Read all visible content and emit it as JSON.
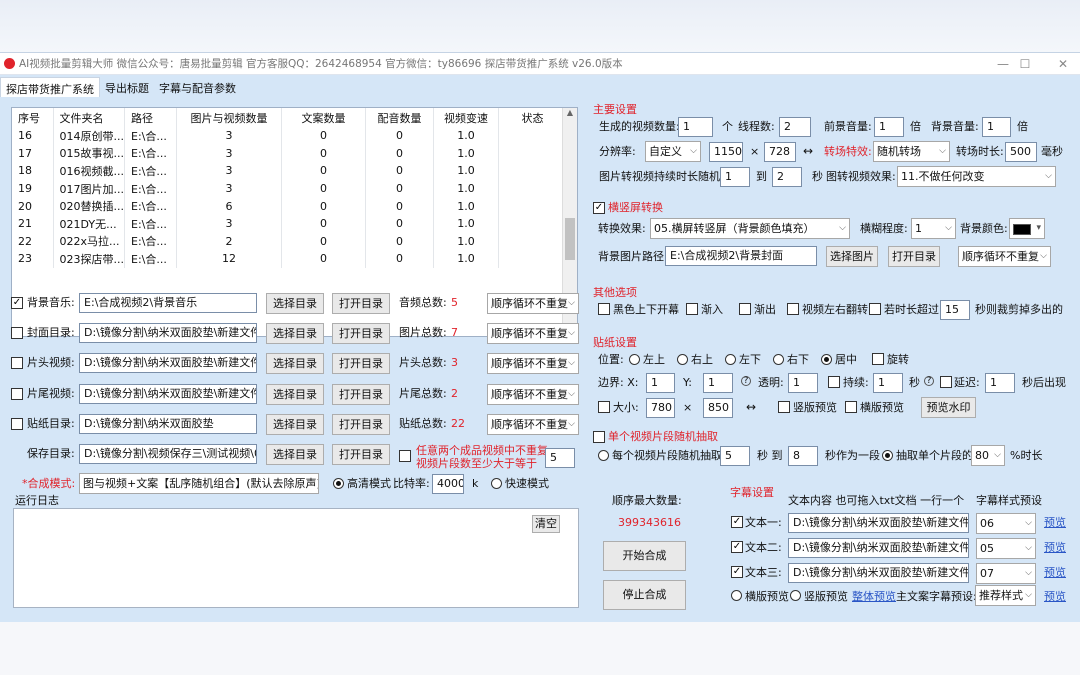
{
  "window": {
    "title": "AI视频批量剪辑大师  微信公众号：唐易批量剪辑  官方客服QQ：2642468954  官方微信：ty86696     探店带货推广系统    v26.0版本",
    "btn_min": "—",
    "btn_max": "☐",
    "btn_close": "✕"
  },
  "tabs": [
    {
      "label": "探店带货推广系统"
    },
    {
      "label": "导出标题"
    },
    {
      "label": "字幕与配音参数"
    }
  ],
  "table": {
    "headers": [
      "序号",
      "文件夹名",
      "路径",
      "图片与视频数量",
      "文案数量",
      "配音数量",
      "视频变速",
      "状态"
    ],
    "rows": [
      [
        "16",
        "014原创带...",
        "E:\\合...",
        "3",
        "0",
        "0",
        "1.0",
        ""
      ],
      [
        "17",
        "015故事视...",
        "E:\\合...",
        "3",
        "0",
        "0",
        "1.0",
        ""
      ],
      [
        "18",
        "016视频截...",
        "E:\\合...",
        "3",
        "0",
        "0",
        "1.0",
        ""
      ],
      [
        "19",
        "017图片加...",
        "E:\\合...",
        "3",
        "0",
        "0",
        "1.0",
        ""
      ],
      [
        "20",
        "020替换插...",
        "E:\\合...",
        "6",
        "0",
        "0",
        "1.0",
        ""
      ],
      [
        "21",
        "021DY无...",
        "E:\\合...",
        "3",
        "0",
        "0",
        "1.0",
        ""
      ],
      [
        "22",
        "022x马拉...",
        "E:\\合...",
        "2",
        "0",
        "0",
        "1.0",
        ""
      ],
      [
        "23",
        "023探店带...",
        "E:\\合...",
        "12",
        "0",
        "0",
        "1.0",
        ""
      ]
    ]
  },
  "dirs": [
    {
      "label": "背景音乐:",
      "checked": true,
      "path": "E:\\合成视频2\\背景音乐",
      "btn1": "选择目录",
      "btn2": "打开目录",
      "count_label": "音频总数:",
      "count": "5",
      "mode": "顺序循环不重复"
    },
    {
      "label": "封面目录:",
      "checked": false,
      "path": "D:\\镜像分割\\纳米双面胶垫\\新建文件夹",
      "btn1": "选择目录",
      "btn2": "打开目录",
      "count_label": "图片总数:",
      "count": "7",
      "mode": "顺序循环不重复"
    },
    {
      "label": "片头视频:",
      "checked": false,
      "path": "D:\\镜像分割\\纳米双面胶垫\\新建文件夹",
      "btn1": "选择目录",
      "btn2": "打开目录",
      "count_label": "片头总数:",
      "count": "3",
      "mode": "顺序循环不重复"
    },
    {
      "label": "片尾视频:",
      "checked": false,
      "path": "D:\\镜像分割\\纳米双面胶垫\\新建文件夹",
      "btn1": "选择目录",
      "btn2": "打开目录",
      "count_label": "片尾总数:",
      "count": "2",
      "mode": "顺序循环不重复"
    },
    {
      "label": "贴纸目录:",
      "checked": false,
      "path": "D:\\镜像分割\\纳米双面胶垫",
      "btn1": "选择目录",
      "btn2": "打开目录",
      "count_label": "贴纸总数:",
      "count": "22",
      "mode": "顺序循环不重复"
    }
  ],
  "save": {
    "label": "保存目录:",
    "path": "D:\\镜像分割\\视频保存三\\测试视频\\040",
    "btn1": "选择目录",
    "btn2": "打开目录",
    "note": "任意两个成品视频中不重复\n视频片段数至少大于等于",
    "note_value": "5"
  },
  "mode": {
    "label": "*合成模式:",
    "value": "图与视频+文案【乱序随机组合】(默认去除原声)",
    "hq": "高清模式",
    "bitrate_label": "比特率:",
    "bitrate": "4000",
    "k": "k",
    "fast": "快速模式"
  },
  "log": {
    "label": "运行日志",
    "clear": "清空"
  },
  "main": {
    "title": "主要设置",
    "gen_label": "生成的视频数量:",
    "gen": "1",
    "ge": "个",
    "threads_label": "线程数:",
    "threads": "2",
    "fg_vol_label": "前景音量:",
    "fg_vol": "1",
    "bei": "倍",
    "bg_vol_label": "背景音量:",
    "bg_vol": "1",
    "bei2": "倍",
    "res_label": "分辨率:",
    "res_mode": "自定义",
    "w": "1150",
    "x": "×",
    "h": "728",
    "swap": "↔",
    "trans_label": "转场特效:",
    "trans": "随机转场",
    "trans_dur_label": "转场时长:",
    "trans_dur": "500",
    "ms": "毫秒",
    "imgdur_label": "图片转视频持续时长随机:",
    "imgdur_a": "1",
    "to": "到",
    "imgdur_b": "2",
    "sec": "秒",
    "imgeff_label": "图转视频效果:",
    "imgeff": "11.不做任何改变"
  },
  "portrait": {
    "title": "横竖屏转换",
    "effect_label": "转换效果:",
    "effect": "05.横屏转竖屏（背景颜色填充）",
    "blur_label": "横糊程度:",
    "blur": "1",
    "color_label": "背景颜色:",
    "bgimg_label": "背景图片路径:",
    "bgimg": "E:\\合成视频2\\背景封面",
    "btn1": "选择图片",
    "btn2": "打开目录",
    "mode": "顺序循环不重复"
  },
  "other": {
    "title": "其他选项",
    "o1": "黑色上下开幕",
    "o2": "渐入",
    "o3": "渐出",
    "o4": "视频左右翻转",
    "o5": "若时长超过",
    "o5_val": "15",
    "o5_tail": "秒则裁剪掉多出的"
  },
  "sticker": {
    "title": "贴纸设置",
    "pos_label": "位置:",
    "pos": [
      "左上",
      "右上",
      "左下",
      "右下",
      "居中"
    ],
    "rotate": "旋转",
    "margin_label": "边界:  X:",
    "x": "1",
    "y_label": "Y:",
    "y": "1",
    "alpha_label": "透明:",
    "alpha": "1",
    "last_label": "持续:",
    "last": "1",
    "sec": "秒",
    "delay_label": "延迟:",
    "delay": "1",
    "delay_tail": "秒后出现",
    "size_label": "大小:",
    "sw": "780",
    "sx": "×",
    "sh": "850",
    "swap": "↔",
    "portrait_prev": "竖版预览",
    "landscape_prev": "横版预览",
    "watermark": "预览水印"
  },
  "clip": {
    "title": "单个视频片段随机抽取",
    "opt1": "每个视频片段随机抽取",
    "a": "5",
    "sec_to": "秒 到",
    "b": "8",
    "tail1": "秒作为一段",
    "opt2": "抽取单个片段的",
    "pct": "80",
    "tail2": "%时长"
  },
  "order": {
    "label": "顺序最大数量:",
    "value": "399343616",
    "start": "开始合成",
    "stop": "停止合成"
  },
  "sub": {
    "title": "字幕设置",
    "content_label": "文本内容  也可拖入txt文档  一行一个",
    "style_label": "字幕样式预设",
    "items": [
      {
        "label": "文本一:",
        "path": "D:\\镜像分割\\纳米双面胶垫\\新建文件夹",
        "style": "06",
        "preview": "预览"
      },
      {
        "label": "文本二:",
        "path": "D:\\镜像分割\\纳米双面胶垫\\新建文件夹",
        "style": "05",
        "preview": "预览"
      },
      {
        "label": "文本三:",
        "path": "D:\\镜像分割\\纳米双面胶垫\\新建文件夹",
        "style": "07",
        "preview": "预览"
      }
    ],
    "landscape": "横版预览",
    "portrait": "竖版预览",
    "whole": "整体预览",
    "main_style_label": "主文案字幕预设:",
    "main_style": "推荐样式",
    "preview": "预览"
  },
  "colors": {
    "accent_red": "#e0232b",
    "window_bg": "#d5e6f7",
    "link": "#2a56c6"
  }
}
